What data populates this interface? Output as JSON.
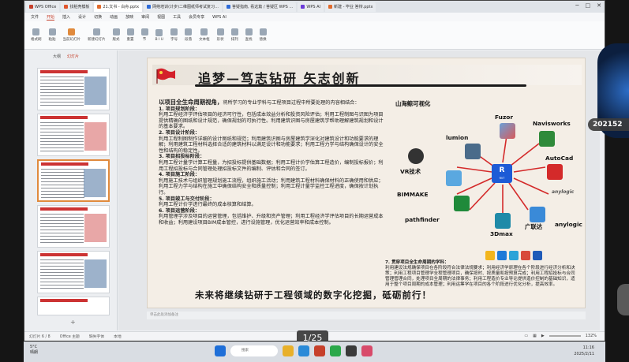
{
  "tabs": [
    {
      "label": "WPS Office",
      "color": "#c6402b"
    },
    {
      "label": "找稻壳模板",
      "color": "#e0552d"
    },
    {
      "label": "21.文书 - 白舟.pptx",
      "color": "#e06b2d",
      "active": true
    },
    {
      "label": "网络培训(计步)二维图纸师考试复习…",
      "color": "#2d6bd9"
    },
    {
      "label": "答疑指南, 看这篇 / 答疑区 WPS …",
      "color": "#2d6bd9"
    },
    {
      "label": "WPS AI",
      "color": "#6b3bd9"
    },
    {
      "label": "新建 - 毕业 答辩.pptx",
      "color": "#e06b2d"
    }
  ],
  "menu": [
    "文件",
    "开始",
    "插入",
    "设计",
    "切换",
    "动画",
    "放映",
    "审阅",
    "视图",
    "工具",
    "会员专享",
    "WPS AI"
  ],
  "menu_active": "开始",
  "ribbon": [
    "格式刷",
    "粘贴",
    "当前幻灯片",
    "新建幻灯片",
    "版式",
    "重置",
    "节",
    "B I U",
    "字号",
    "段落",
    "文本框",
    "形状",
    "排列",
    "查找",
    "替换"
  ],
  "thumb_tabs": [
    "大纲",
    "幻灯片"
  ],
  "thumb_tab_active": "幻灯片",
  "thumbs": [
    "4",
    "5",
    "6",
    "7",
    "8",
    "9",
    "10"
  ],
  "add_slide": "+",
  "slide": {
    "title": "追梦—笃志钻研  矢志创新",
    "lead": "以项目全生命周期视角，",
    "lead_rest": "将所学习的专业学科与工程项目过程中所要处理的内容相结合：",
    "sections": [
      {
        "h": "1. 项目规划阶段：",
        "lines": [
          "利用工程经济学评估项目的经济可行性，包括成本效益分析和投资风险评估；利用工程制图与识图为项目提供精确的图纸和设计规范，确保规划的可执行性。利用建筑识图与房屋建筑学帮助理解建筑规划和设计的基本要求。"
        ]
      },
      {
        "h": "2. 项目设计阶段：",
        "lines": [
          "利用工程制图制作详细的设计图纸和规范；利用建筑识图与房屋建筑学深化对建筑设计和功能要求的理解；利用建筑工程材料选择合适的建筑材料以满足设计和功能要求；利用工程力学与结构确保设计的安全性和结构的稳定性。"
        ]
      },
      {
        "h": "3. 项目招投标阶段：",
        "lines": [
          "利用工程计量学计算工程量，为招投标提供基础数据；利用工程计价学估算工程造价，编制投标报价；利用工程招投标与合同管理处理招投标文件的编制、评估和合同的签订。"
        ]
      },
      {
        "h": "4. 项目施工阶段：",
        "lines": [
          "利用施工技术与组织管理规划施工流程，组织施工活动；利用建筑工程材料确保材料的正确使用和供应；利用工程力学与结构在施工中确保结构安全和质量控制；利用工程计量学监控工程进度，确保按计划执行。"
        ]
      },
      {
        "h": "5. 项目竣工与交付阶段：",
        "lines": [
          "利用工程计价学进行最终的成本核算和结算。"
        ]
      },
      {
        "h": "6. 项目运营阶段：",
        "lines": [
          "利用管理学涉及项目的运营管理，包括维护、升级和资产管理；利用工程经济学评估项目的长期运营成本和收益；利用建设项目BIM成本管控，进行设施管理，优化运营效率和成本控制。"
        ]
      }
    ],
    "software": {
      "hub": "R",
      "hub_sub": "RVT",
      "items": [
        "山海鲸可视化",
        "lumion",
        "Fuzor",
        "Navisworks",
        "VR技术",
        "AutoCad",
        "BIMMAKE",
        "anylogic",
        "pathfinder",
        "3Dmax",
        "广联达",
        "anylogic"
      ]
    },
    "right": {
      "h": "7. 贯穿项目全生命周期的学科：",
      "text": "利用建设法规确保项目在各阶段符合法律法规要求；利用经济学原理在各个阶段进行经济分析和决策；利用工程项目管理学全程管理项目，确保按时、按质量和按预算完成；利用工程招投标与合同管理管理合同，处理项目全周期的法律事务；利用工程造价专业导论提供造价控制的基础知识，适用于整个项目周期的成本管理；利用运筹学在项目的各个阶段进行优化分析，提高效率。"
    },
    "slogan": "未来将继续钻研于工程领域的数字化挖掘，砥砺前行！"
  },
  "notes_placeholder": "单击此处添加备注",
  "status": [
    "幻灯片 6 / 8",
    "Office 主题",
    "缺失字体",
    "本地"
  ],
  "zoom": "132%",
  "page_counter": "1/25",
  "weather": {
    "temp": "5°C",
    "desc": "晴朗"
  },
  "search": "搜索",
  "clock": {
    "time": "11:16",
    "date": "2025/2/11"
  },
  "cam_label": "202152"
}
